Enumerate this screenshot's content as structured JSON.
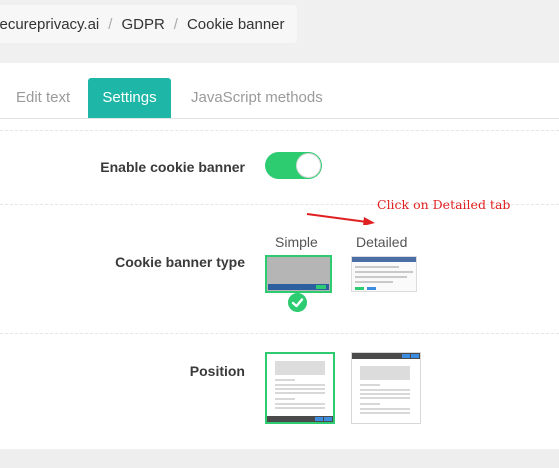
{
  "breadcrumb": {
    "items": [
      "secureprivacy.ai",
      "GDPR",
      "Cookie banner"
    ],
    "separator": "/"
  },
  "tabs": [
    {
      "label": "Edit text",
      "active": false
    },
    {
      "label": "Settings",
      "active": true
    },
    {
      "label": "JavaScript methods",
      "active": false
    }
  ],
  "settings": {
    "enable_label": "Enable cookie banner",
    "enable_value": true,
    "type_label": "Cookie banner type",
    "type_options": [
      "Simple",
      "Detailed"
    ],
    "type_selected": "Simple",
    "position_label": "Position",
    "position_options": [
      "bottom",
      "top"
    ],
    "position_selected": "bottom"
  },
  "annotation": {
    "text": "Click on Detailed tab",
    "color": "#e02020"
  },
  "colors": {
    "accent": "#1eb7a7",
    "toggle_on": "#2ecc71",
    "selected_border": "#2ecc71"
  }
}
